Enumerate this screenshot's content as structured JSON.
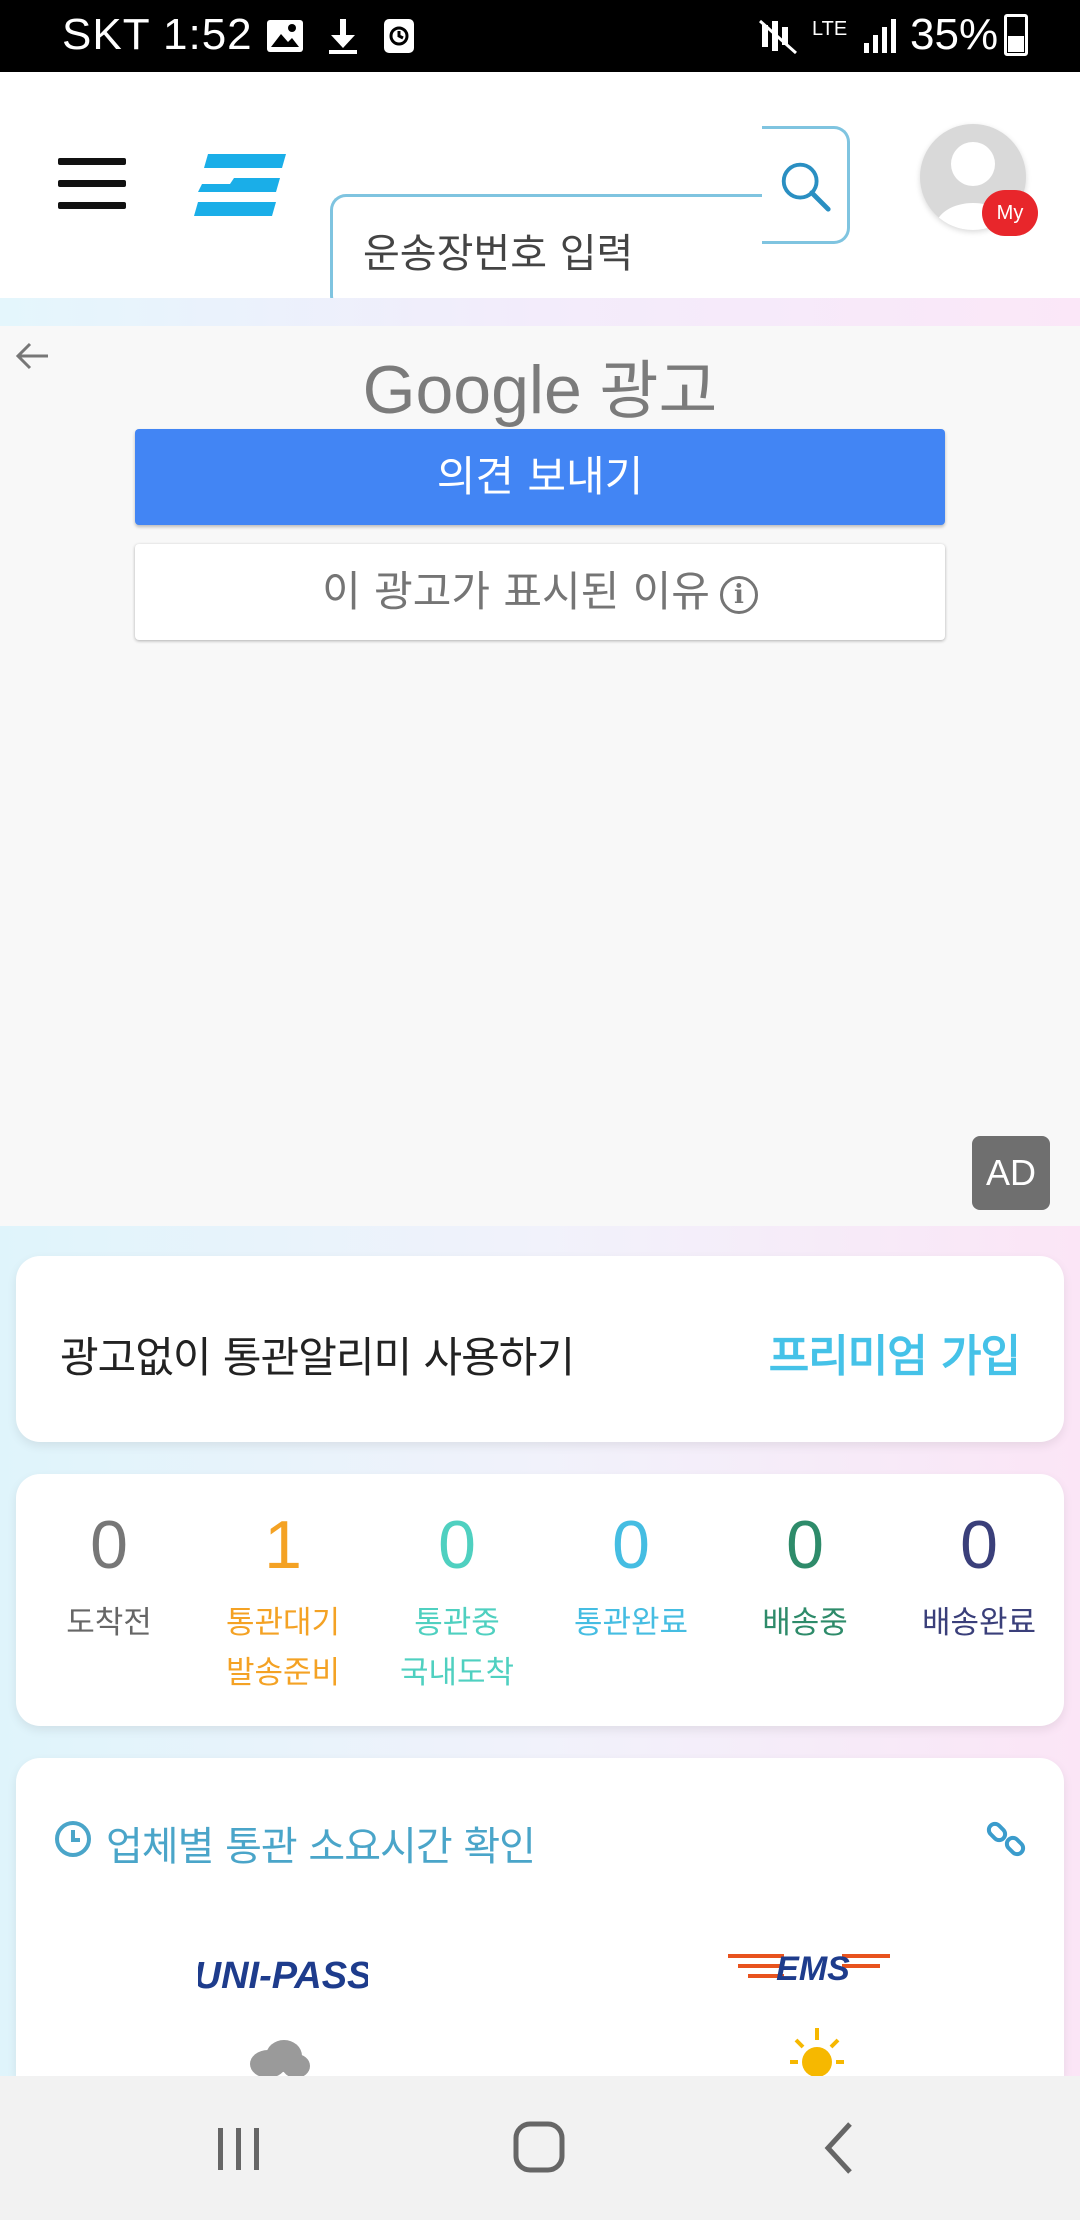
{
  "status_bar": {
    "carrier_time": "SKT 1:52",
    "network": "LTE",
    "battery": "35%"
  },
  "header": {
    "search_placeholder": "운송장번호 입력",
    "my_badge": "My",
    "accent_color": "#1aaee8"
  },
  "ad": {
    "provider_label": "Google",
    "provider_suffix": "광고",
    "feedback_button": "의견 보내기",
    "why_button": "이 광고가 표시된 이유",
    "ad_badge": "AD"
  },
  "premium": {
    "text": "광고없이 통관알리미 사용하기",
    "link": "프리미엄 가입"
  },
  "status_counts": [
    {
      "count": "0",
      "label": "도착전",
      "color": "#777777"
    },
    {
      "count": "1",
      "label": "통관대기\n발송준비",
      "color": "#f4a224"
    },
    {
      "count": "0",
      "label": "통관중\n국내도착",
      "color": "#4fd0c0"
    },
    {
      "count": "0",
      "label": "통관완료",
      "color": "#45bde2"
    },
    {
      "count": "0",
      "label": "배송중",
      "color": "#2e8b6a"
    },
    {
      "count": "0",
      "label": "배송완료",
      "color": "#3a3f7a"
    }
  ],
  "clearance_time": {
    "title": "업체별 통관 소요시간 확인",
    "unipass_logo": "UNI-PASS",
    "ems_logo": "EMS"
  }
}
